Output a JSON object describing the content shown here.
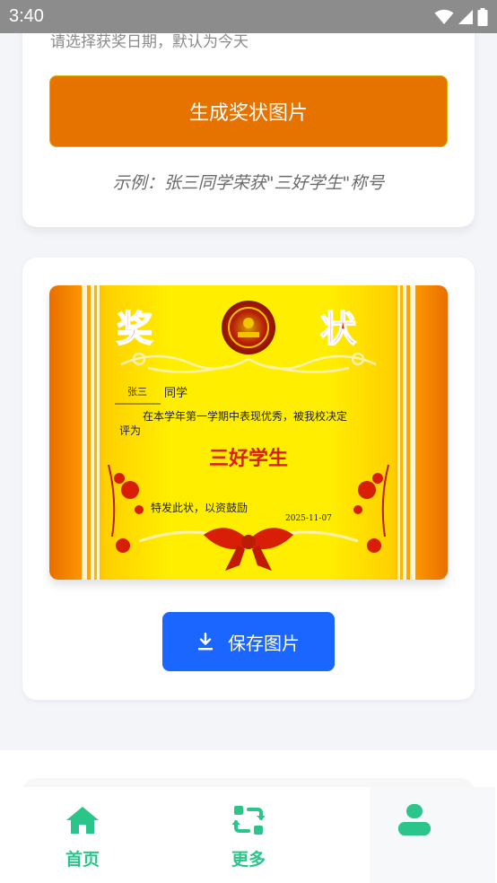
{
  "status_bar": {
    "time": "3:40"
  },
  "form": {
    "date_hint": "请选择获奖日期，默认为今天",
    "generate_button": "生成奖状图片",
    "example": "示例：张三同学荣获\"三好学生\"称号"
  },
  "certificate": {
    "title_left": "奖",
    "title_right": "状",
    "name": "张三",
    "name_suffix": "同学",
    "body_line1": "在本学年第一学期中表现优秀，被我校决定",
    "body_line2": "评为",
    "honor": "三好学生",
    "closing": "特发此状，以资鼓励",
    "date": "2025-11-07"
  },
  "actions": {
    "save_button": "保存图片"
  },
  "bottom_nav": {
    "items": [
      {
        "label": "首页",
        "icon": "home-icon"
      },
      {
        "label": "更多",
        "icon": "refresh-icon"
      },
      {
        "label": "",
        "icon": "user-icon"
      }
    ]
  },
  "colors": {
    "accent_orange": "#e67300",
    "primary_blue": "#1a66ff",
    "nav_green": "#2bc48a",
    "certificate_red": "#d81e06",
    "certificate_yellow": "#ffe600"
  }
}
